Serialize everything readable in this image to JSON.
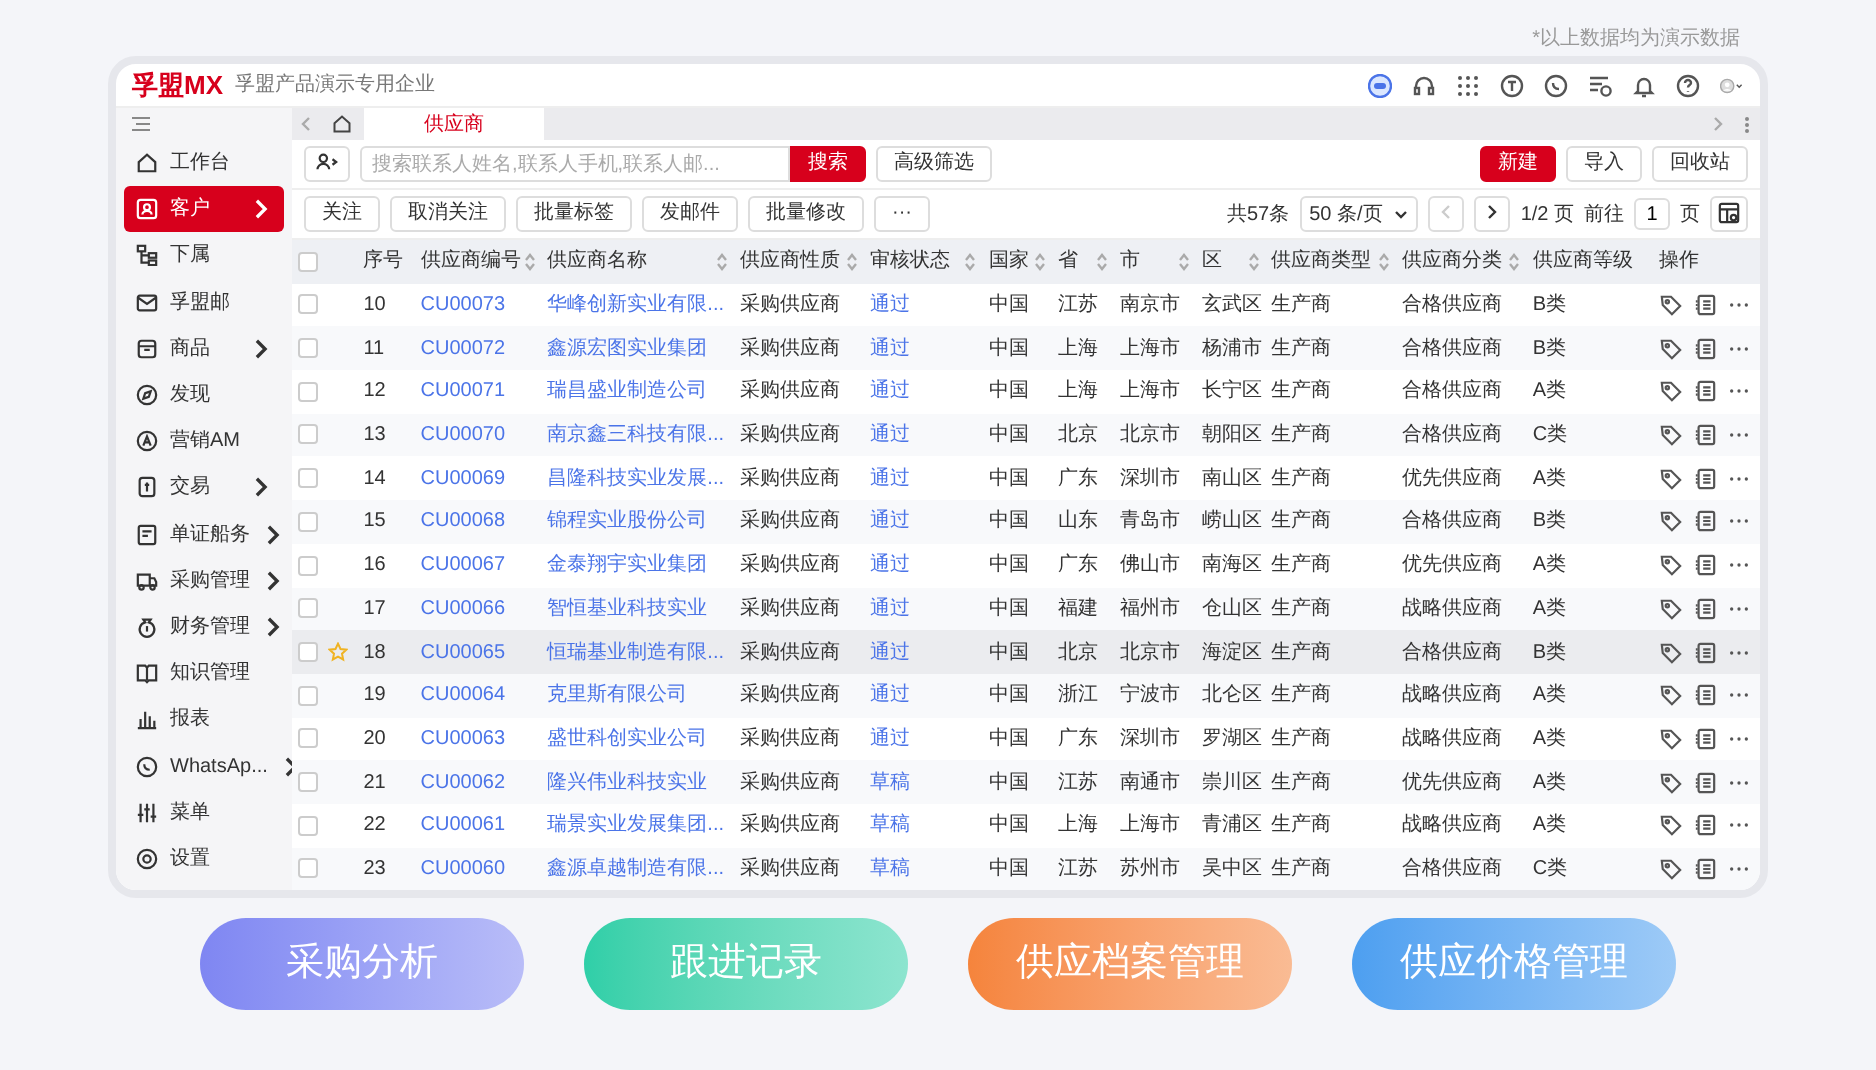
{
  "demo_note": "*以上数据均为演示数据",
  "header": {
    "logo": "孚盟MX",
    "company": "孚盟产品演示专用企业"
  },
  "sidebar": {
    "items": [
      {
        "label": "工作台",
        "selected": false,
        "has_submenu": false
      },
      {
        "label": "客户",
        "selected": true,
        "has_submenu": true
      },
      {
        "label": "下属",
        "selected": false,
        "has_submenu": false
      },
      {
        "label": "孚盟邮",
        "selected": false,
        "has_submenu": false
      },
      {
        "label": "商品",
        "selected": false,
        "has_submenu": true
      },
      {
        "label": "发现",
        "selected": false,
        "has_submenu": false
      },
      {
        "label": "营销AM",
        "selected": false,
        "has_submenu": false
      },
      {
        "label": "交易",
        "selected": false,
        "has_submenu": true
      },
      {
        "label": "单证船务",
        "selected": false,
        "has_submenu": true
      },
      {
        "label": "采购管理",
        "selected": false,
        "has_submenu": true
      },
      {
        "label": "财务管理",
        "selected": false,
        "has_submenu": true
      },
      {
        "label": "知识管理",
        "selected": false,
        "has_submenu": false
      },
      {
        "label": "报表",
        "selected": false,
        "has_submenu": false
      },
      {
        "label": "WhatsAp...",
        "selected": false,
        "has_submenu": true
      },
      {
        "label": "菜单",
        "selected": false,
        "has_submenu": false
      },
      {
        "label": "设置",
        "selected": false,
        "has_submenu": false
      }
    ]
  },
  "tabs": [
    {
      "label": "供应商",
      "selected": true
    }
  ],
  "search": {
    "placeholder": "搜索联系人姓名,联系人手机,联系人邮...",
    "search_button": "搜索",
    "advanced_button": "高级筛选"
  },
  "actions": [
    "新建",
    "导入",
    "回收站"
  ],
  "bulk_actions": [
    "关注",
    "取消关注",
    "批量标签",
    "发邮件",
    "批量修改",
    "···"
  ],
  "pagination": {
    "total": "共57条",
    "page_size": "50 条/页",
    "prev_disabled": true,
    "page": "1/2 页",
    "goto_label": "前往",
    "goto_value": "1",
    "goto_unit": "页"
  },
  "table": {
    "select_all_checked": false,
    "columns": [
      {
        "label": "序号",
        "sortable": false
      },
      {
        "label": "供应商编号",
        "sortable": true
      },
      {
        "label": "供应商名称",
        "sortable": true
      },
      {
        "label": "供应商性质",
        "sortable": true
      },
      {
        "label": "审核状态",
        "sortable": true
      },
      {
        "label": "国家",
        "sortable": true
      },
      {
        "label": "省",
        "sortable": true
      },
      {
        "label": "市",
        "sortable": true
      },
      {
        "label": "区",
        "sortable": true
      },
      {
        "label": "供应商类型",
        "sortable": true
      },
      {
        "label": "供应商分类",
        "sortable": true
      },
      {
        "label": "供应商等级",
        "sortable": false
      },
      {
        "label": "操作",
        "sortable": false
      }
    ],
    "rows": [
      {
        "checked": false,
        "starred": false,
        "selected": false,
        "cells": [
          "10",
          "CU00073",
          "华峰创新实业有限...",
          "采购供应商",
          "通过",
          "中国",
          "江苏",
          "南京市",
          "玄武区",
          "生产商",
          "合格供应商",
          "B类"
        ]
      },
      {
        "checked": false,
        "starred": false,
        "selected": false,
        "cells": [
          "11",
          "CU00072",
          "鑫源宏图实业集团",
          "采购供应商",
          "通过",
          "中国",
          "上海",
          "上海市",
          "杨浦市",
          "生产商",
          "合格供应商",
          "B类"
        ]
      },
      {
        "checked": false,
        "starred": false,
        "selected": false,
        "cells": [
          "12",
          "CU00071",
          "瑞昌盛业制造公司",
          "采购供应商",
          "通过",
          "中国",
          "上海",
          "上海市",
          "长宁区",
          "生产商",
          "合格供应商",
          "A类"
        ]
      },
      {
        "checked": false,
        "starred": false,
        "selected": false,
        "cells": [
          "13",
          "CU00070",
          "南京鑫三科技有限...",
          "采购供应商",
          "通过",
          "中国",
          "北京",
          "北京市",
          "朝阳区",
          "生产商",
          "合格供应商",
          "C类"
        ]
      },
      {
        "checked": false,
        "starred": false,
        "selected": false,
        "cells": [
          "14",
          "CU00069",
          "昌隆科技实业发展...",
          "采购供应商",
          "通过",
          "中国",
          "广东",
          "深圳市",
          "南山区",
          "生产商",
          "优先供应商",
          "A类"
        ]
      },
      {
        "checked": false,
        "starred": false,
        "selected": false,
        "cells": [
          "15",
          "CU00068",
          "锦程实业股份公司",
          "采购供应商",
          "通过",
          "中国",
          "山东",
          "青岛市",
          "崂山区",
          "生产商",
          "合格供应商",
          "B类"
        ]
      },
      {
        "checked": false,
        "starred": false,
        "selected": false,
        "cells": [
          "16",
          "CU00067",
          "金泰翔宇实业集团",
          "采购供应商",
          "通过",
          "中国",
          "广东",
          "佛山市",
          "南海区",
          "生产商",
          "优先供应商",
          "A类"
        ]
      },
      {
        "checked": false,
        "starred": false,
        "selected": false,
        "cells": [
          "17",
          "CU00066",
          "智恒基业科技实业",
          "采购供应商",
          "通过",
          "中国",
          "福建",
          "福州市",
          "仓山区",
          "生产商",
          "战略供应商",
          "A类"
        ]
      },
      {
        "checked": false,
        "starred": true,
        "selected": true,
        "cells": [
          "18",
          "CU00065",
          "恒瑞基业制造有限...",
          "采购供应商",
          "通过",
          "中国",
          "北京",
          "北京市",
          "海淀区",
          "生产商",
          "合格供应商",
          "B类"
        ]
      },
      {
        "checked": false,
        "starred": false,
        "selected": false,
        "cells": [
          "19",
          "CU00064",
          "克里斯有限公司",
          "采购供应商",
          "通过",
          "中国",
          "浙江",
          "宁波市",
          "北仑区",
          "生产商",
          "战略供应商",
          "A类"
        ]
      },
      {
        "checked": false,
        "starred": false,
        "selected": false,
        "cells": [
          "20",
          "CU00063",
          "盛世科创实业公司",
          "采购供应商",
          "通过",
          "中国",
          "广东",
          "深圳市",
          "罗湖区",
          "生产商",
          "战略供应商",
          "A类"
        ]
      },
      {
        "checked": false,
        "starred": false,
        "selected": false,
        "cells": [
          "21",
          "CU00062",
          "隆兴伟业科技实业",
          "采购供应商",
          "草稿",
          "中国",
          "江苏",
          "南通市",
          "崇川区",
          "生产商",
          "优先供应商",
          "A类"
        ]
      },
      {
        "checked": false,
        "starred": false,
        "selected": false,
        "cells": [
          "22",
          "CU00061",
          "瑞景实业发展集团...",
          "采购供应商",
          "草稿",
          "中国",
          "上海",
          "上海市",
          "青浦区",
          "生产商",
          "战略供应商",
          "A类"
        ]
      },
      {
        "checked": false,
        "starred": false,
        "selected": false,
        "cells": [
          "23",
          "CU00060",
          "鑫源卓越制造有限...",
          "采购供应商",
          "草稿",
          "中国",
          "江苏",
          "苏州市",
          "吴中区",
          "生产商",
          "合格供应商",
          "C类"
        ]
      }
    ]
  },
  "feature_pills": [
    {
      "label": "采购分析",
      "color": "#7f86f2"
    },
    {
      "label": "跟进记录",
      "color": "#2fcfa8"
    },
    {
      "label": "供应档案管理",
      "color": "#f5843c"
    },
    {
      "label": "供应价格管理",
      "color": "#4d9ff0"
    }
  ]
}
